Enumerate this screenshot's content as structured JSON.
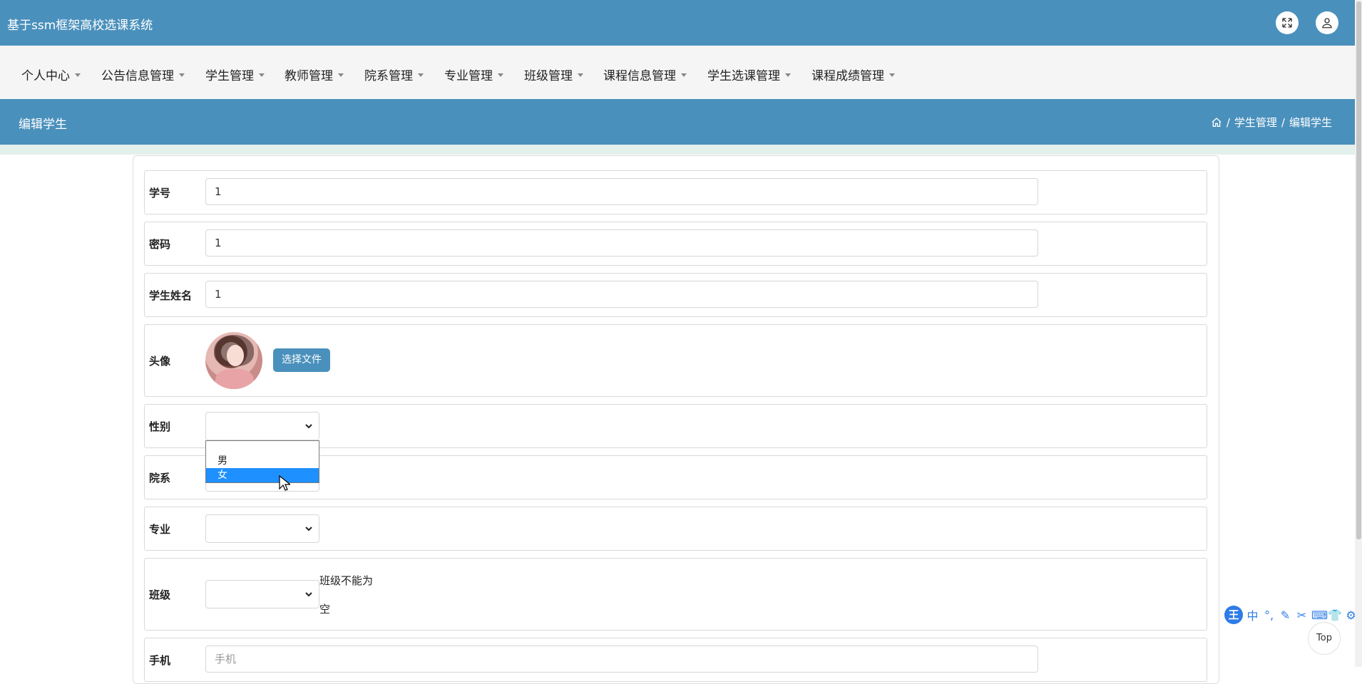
{
  "app": {
    "title": "基于ssm框架高校选课系统"
  },
  "menu": [
    "个人中心",
    "公告信息管理",
    "学生管理",
    "教师管理",
    "院系管理",
    "专业管理",
    "班级管理",
    "课程信息管理",
    "学生选课管理",
    "课程成绩管理"
  ],
  "page": {
    "title": "编辑学生",
    "breadcrumb": [
      "学生管理",
      "编辑学生"
    ],
    "breadcrumb_sep": "/"
  },
  "form": {
    "student_no": {
      "label": "学号",
      "value": "1"
    },
    "password": {
      "label": "密码",
      "value": "1"
    },
    "student_name": {
      "label": "学生姓名",
      "value": "1"
    },
    "avatar": {
      "label": "头像",
      "button": "选择文件"
    },
    "gender": {
      "label": "性别",
      "value": "",
      "options": [
        "男",
        "女"
      ],
      "highlighted": "女"
    },
    "department": {
      "label": "院系",
      "value": ""
    },
    "major": {
      "label": "专业",
      "value": ""
    },
    "class": {
      "label": "班级",
      "value": "",
      "error_line1": "班级不能为",
      "error_line2": "空"
    },
    "phone": {
      "label": "手机",
      "placeholder": "手机"
    }
  },
  "ime": {
    "logo": "王",
    "mode": "中"
  },
  "top_button": "Top",
  "colors": {
    "header": "#4a90bc",
    "menu_bg": "#f5f5f5",
    "highlight": "#1e90ff"
  }
}
